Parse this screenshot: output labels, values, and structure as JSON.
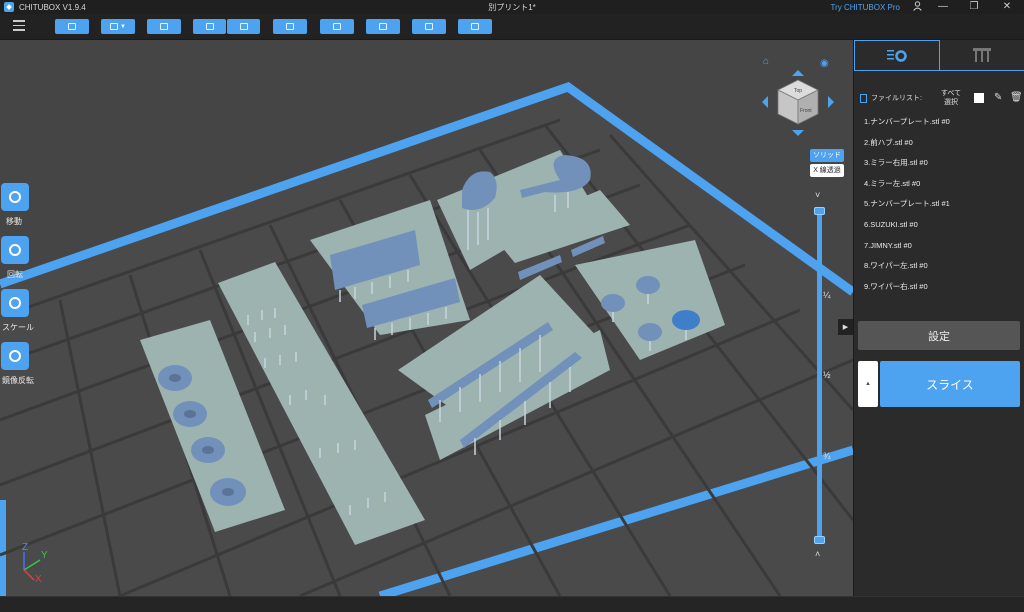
{
  "window": {
    "app_title": "CHITUBOX V1.9.4",
    "doc_title": "別プリント1*",
    "try_pro": "Try CHITUBOX Pro",
    "user_icon": "user-icon",
    "minimize": "—",
    "maximize": "❐",
    "close": "✕"
  },
  "toolbar": {
    "menu_icon": "hamburger-menu-icon",
    "buttons": [
      "open-file-icon",
      "save-icon",
      "workspace-icon",
      "undo-icon",
      "redo-icon",
      "copy-icon",
      "arrange-icon",
      "support-icon",
      "hollow-icon",
      "drill-icon"
    ]
  },
  "tools": {
    "move": "移動",
    "rotate": "回転",
    "scale": "スケール",
    "mirror": "鏡像反転"
  },
  "view": {
    "solid": "ソリッド",
    "xray": "X 線透過",
    "home_icon": "home-icon",
    "eye_icon": "eye-icon",
    "cube_top": "Top",
    "cube_front": "Front"
  },
  "slider": {
    "q1": "¼",
    "half": "½",
    "q3": "¾",
    "up": "˄",
    "down": "˅"
  },
  "axes": {
    "x": "X",
    "y": "Y",
    "z": "Z"
  },
  "panel": {
    "file_list_label": "ファイルリスト:",
    "select_all": "すべて選択",
    "files": [
      "1.ナンバープレート.stl #0",
      "2.前ハブ.stl #0",
      "3.ミラー右用.stl #0",
      "4.ミラー左.stl #0",
      "5.ナンバープレート.stl #1",
      "6.SUZUKI.stl #0",
      "7.JIMNY.stl #0",
      "8.ワイパー左.stl #0",
      "9.ワイパー右.stl #0"
    ],
    "settings_label": "設定",
    "slice_label": "スライス",
    "slice_side": "▲"
  },
  "colors": {
    "accent": "#4da3f0",
    "viewport": "#454545",
    "plate": "#9cb3b0",
    "model": "#6f8fb8"
  }
}
